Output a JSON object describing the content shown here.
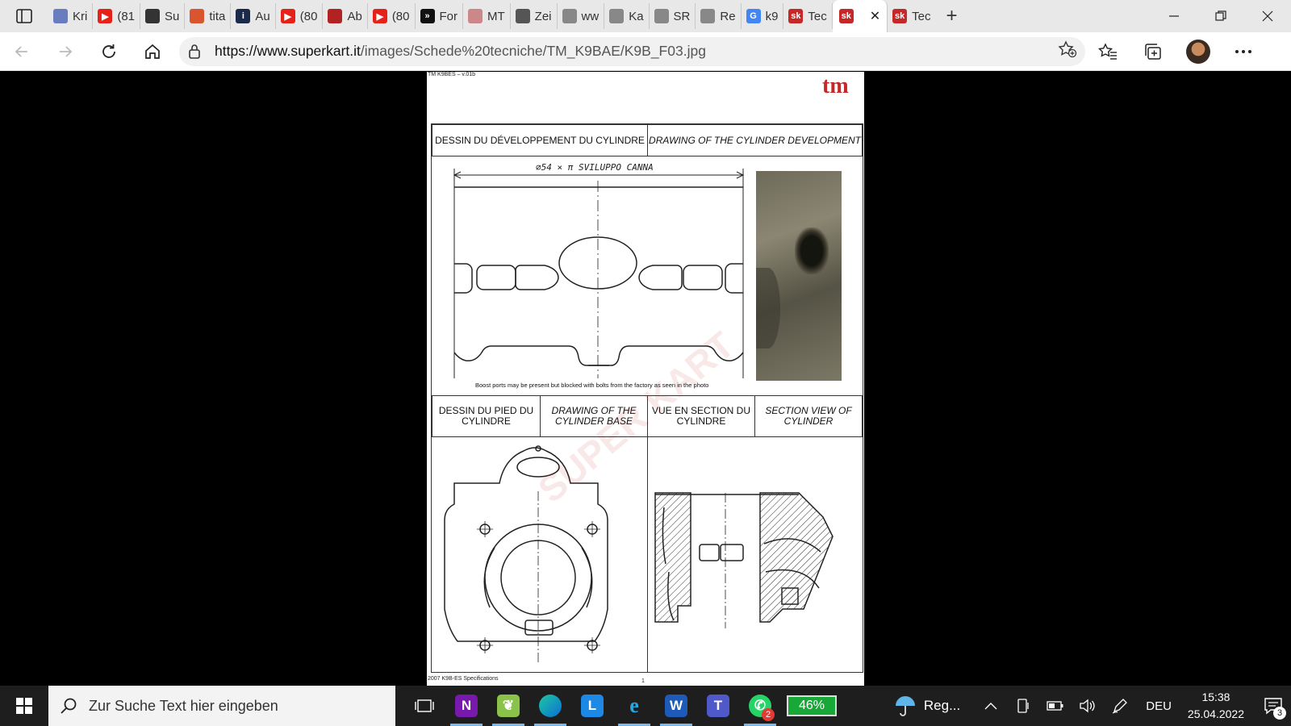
{
  "browser": {
    "tabs": [
      {
        "label": "Kri",
        "icon": "document-icon",
        "color": "#6a7cc0"
      },
      {
        "label": "(81",
        "icon": "youtube-icon",
        "color": "#e62117"
      },
      {
        "label": "Su",
        "icon": "tool-icon",
        "color": "#333333"
      },
      {
        "label": "tita",
        "icon": "image-icon",
        "color": "#d8552e"
      },
      {
        "label": "Au",
        "icon": "info-icon",
        "color": "#1b2a4a"
      },
      {
        "label": "(80",
        "icon": "youtube-icon",
        "color": "#e62117"
      },
      {
        "label": "Ab",
        "icon": "abarth-icon",
        "color": "#b22222"
      },
      {
        "label": "(80",
        "icon": "youtube-icon",
        "color": "#e62117"
      },
      {
        "label": "For",
        "icon": "forum-icon",
        "color": "#111111"
      },
      {
        "label": "MT",
        "icon": "site-icon",
        "color": "#cc8888"
      },
      {
        "label": "Zei",
        "icon": "zeit-icon",
        "color": "#555555"
      },
      {
        "label": "ww",
        "icon": "loading-icon",
        "color": "#888888"
      },
      {
        "label": "Ka",
        "icon": "page-icon",
        "color": "#888888"
      },
      {
        "label": "SR",
        "icon": "page-icon",
        "color": "#888888"
      },
      {
        "label": "Re",
        "icon": "page-icon",
        "color": "#888888"
      },
      {
        "label": "k9",
        "icon": "google-icon",
        "color": "#4285f4"
      },
      {
        "label": "Tec",
        "icon": "superkart-icon",
        "color": "#c62828"
      }
    ],
    "active_tab": {
      "label": "",
      "icon": "superkart-icon",
      "close": "✕"
    },
    "after_tab": {
      "label": "Tec",
      "icon": "superkart-icon"
    },
    "new_tab": "+",
    "url_host": "https://www.superkart.it",
    "url_path": "/images/Schede%20tecniche/TM_K9BAE/K9B_F03.jpg"
  },
  "document": {
    "header_code": "TM K9BES – v.01b",
    "logo_text": "tm",
    "top_header_fr": "DESSIN DU DÉVELOPPEMENT DU CYLINDRE",
    "top_header_en": "DRAWING OF THE CYLINDER DEVELOPMENT",
    "dimension_note": "⌀54 × π   SVILUPPO  CANNA",
    "caption": "Boost ports may be present but blocked with bolts from the factory as seen in the photo",
    "base_header_fr": "DESSIN DU PIED DU CYLINDRE",
    "base_header_en": "DRAWING OF THE CYLINDER BASE",
    "section_header_fr": "VUE EN SECTION DU CYLINDRE",
    "section_header_en": "SECTION VIEW OF CYLINDER",
    "footer": "2007 K9B-ES Specifications",
    "page_number": "1",
    "watermark_text": "SUPER KART"
  },
  "taskbar": {
    "search_placeholder": "Zur Suche Text hier eingeben",
    "battery_app": "46%",
    "whatsapp_badge": "2",
    "weather": "Reg...",
    "language": "DEU",
    "time": "15:38",
    "date": "25.04.2022",
    "notification_count": "3"
  }
}
